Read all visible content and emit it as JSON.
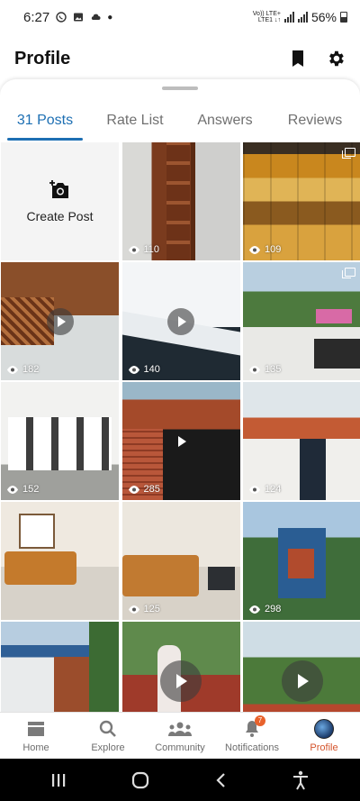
{
  "status": {
    "time": "6:27",
    "volte": "Vo)) LTE+",
    "volte2": "LTE1 ↓↑",
    "battery": "56%"
  },
  "header": {
    "title": "Profile"
  },
  "tabs": [
    {
      "label": "31 Posts",
      "active": true
    },
    {
      "label": "Rate List",
      "active": false
    },
    {
      "label": "Answers",
      "active": false
    },
    {
      "label": "Reviews",
      "active": false
    }
  ],
  "create_post": {
    "label": "Create Post"
  },
  "posts": [
    {
      "views": "110",
      "video": false,
      "multi": false
    },
    {
      "views": "109",
      "video": false,
      "multi": true
    },
    {
      "views": "182",
      "video": true,
      "multi": false
    },
    {
      "views": "140",
      "video": true,
      "multi": false
    },
    {
      "views": "135",
      "video": false,
      "multi": true
    },
    {
      "views": "152",
      "video": false,
      "multi": false
    },
    {
      "views": "285",
      "video": true,
      "multi": false
    },
    {
      "views": "124",
      "video": false,
      "multi": false
    },
    {
      "views": "",
      "video": false,
      "multi": false
    },
    {
      "views": "125",
      "video": false,
      "multi": false
    },
    {
      "views": "298",
      "video": false,
      "multi": false
    },
    {
      "views": "",
      "video": false,
      "multi": false
    },
    {
      "views": "",
      "video": true,
      "multi": false
    },
    {
      "views": "",
      "video": true,
      "multi": false
    }
  ],
  "bottom_nav": [
    {
      "label": "Home",
      "icon": "home-icon"
    },
    {
      "label": "Explore",
      "icon": "search-icon"
    },
    {
      "label": "Community",
      "icon": "community-icon"
    },
    {
      "label": "Notifications",
      "icon": "bell-icon",
      "badge": "7"
    },
    {
      "label": "Profile",
      "icon": "avatar",
      "active": true
    }
  ],
  "colors": {
    "accent": "#1d6fb3",
    "active_nav": "#d4542c",
    "badge": "#e8622c"
  }
}
